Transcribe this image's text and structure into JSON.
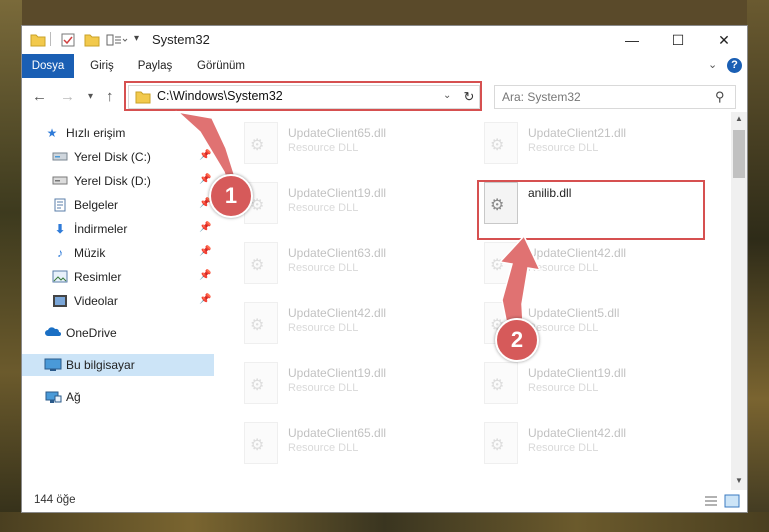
{
  "window": {
    "title": "System32",
    "controls": {
      "minimize": "—",
      "maximize": "☐",
      "close": "✕"
    }
  },
  "ribbon": {
    "tabs": [
      {
        "label": "Dosya",
        "active": true
      },
      {
        "label": "Giriş",
        "active": false
      },
      {
        "label": "Paylaş",
        "active": false
      },
      {
        "label": "Görünüm",
        "active": false
      }
    ]
  },
  "nav": {
    "address": "C:\\Windows\\System32",
    "search_placeholder": "Ara: System32"
  },
  "sidebar": {
    "items": [
      {
        "label": "Hızlı erişim",
        "icon": "star-icon",
        "pinned": false
      },
      {
        "label": "Yerel Disk (C:)",
        "icon": "drive-icon",
        "pinned": true
      },
      {
        "label": "Yerel Disk (D:)",
        "icon": "drive-icon",
        "pinned": true
      },
      {
        "label": "Belgeler",
        "icon": "documents-icon",
        "pinned": true
      },
      {
        "label": "İndirmeler",
        "icon": "downloads-icon",
        "pinned": true
      },
      {
        "label": "Müzik",
        "icon": "music-icon",
        "pinned": true
      },
      {
        "label": "Resimler",
        "icon": "pictures-icon",
        "pinned": true
      },
      {
        "label": "Videolar",
        "icon": "videos-icon",
        "pinned": true
      },
      {
        "label": "OneDrive",
        "icon": "cloud-icon",
        "pinned": false
      },
      {
        "label": "Bu bilgisayar",
        "icon": "computer-icon",
        "pinned": false,
        "selected": true
      },
      {
        "label": "Ağ",
        "icon": "network-icon",
        "pinned": false
      }
    ]
  },
  "files": [
    {
      "name": "UpdateClient65.dll",
      "type": "Resource DLL",
      "faded": true
    },
    {
      "name": "UpdateClient21.dll",
      "type": "Resource DLL",
      "faded": true
    },
    {
      "name": "UpdateClient19.dll",
      "type": "Resource DLL",
      "faded": true
    },
    {
      "name": "anilib.dll",
      "type": "",
      "faded": false
    },
    {
      "name": "UpdateClient63.dll",
      "type": "Resource DLL",
      "faded": true
    },
    {
      "name": "UpdateClient42.dll",
      "type": "Resource DLL",
      "faded": true
    },
    {
      "name": "UpdateClient42.dll",
      "type": "Resource DLL",
      "faded": true
    },
    {
      "name": "UpdateClient5.dll",
      "type": "Resource DLL",
      "faded": true
    },
    {
      "name": "UpdateClient19.dll",
      "type": "Resource DLL",
      "faded": true
    },
    {
      "name": "UpdateClient19.dll",
      "type": "Resource DLL",
      "faded": true
    },
    {
      "name": "UpdateClient65.dll",
      "type": "Resource DLL",
      "faded": true
    },
    {
      "name": "UpdateClient42.dll",
      "type": "Resource DLL",
      "faded": true
    }
  ],
  "status": {
    "count": "144 öğe"
  },
  "callouts": {
    "one": "1",
    "two": "2"
  },
  "colors": {
    "accent": "#1a5fb4",
    "highlight": "#d65050",
    "selected": "#cce4f7"
  }
}
